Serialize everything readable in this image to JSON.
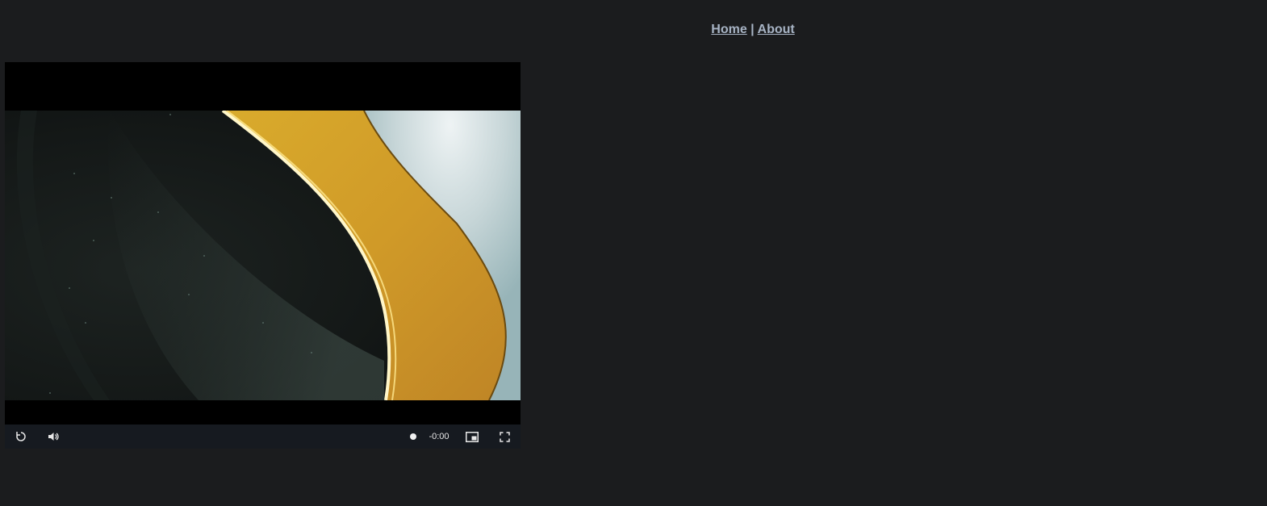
{
  "nav": {
    "home_label": "Home",
    "separator": "|",
    "about_label": "About"
  },
  "player": {
    "remaining_time": "-0:00",
    "progress": 1.0,
    "icons": {
      "replay": "replay-icon",
      "volume": "volume-icon",
      "pip": "picture-in-picture-icon",
      "fullscreen": "fullscreen-icon"
    },
    "colors": {
      "background": "#000000",
      "controls_bar": "#161a20",
      "accent_gold": "#d4a22a"
    }
  }
}
